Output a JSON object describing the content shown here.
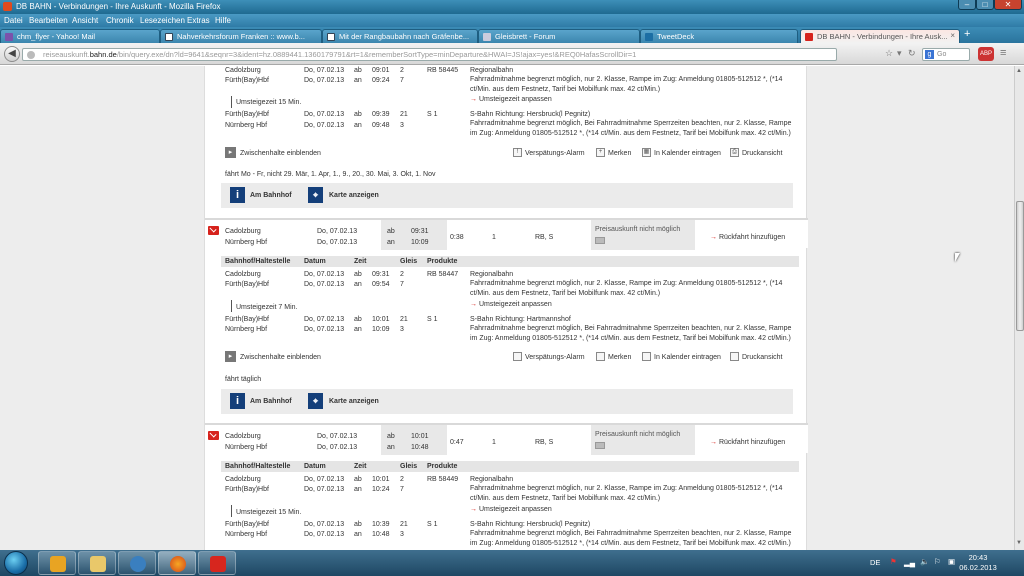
{
  "window": {
    "title": "DB BAHN - Verbindungen - Ihre Auskunft - Mozilla Firefox",
    "controls": {
      "minimize": "–",
      "maximize": "□",
      "close": "✕"
    }
  },
  "menu": [
    "Datei",
    "Bearbeiten",
    "Ansicht",
    "Chronik",
    "Lesezeichen",
    "Extras",
    "Hilfe"
  ],
  "tabs": [
    {
      "label": "chm_flyer - Yahoo! Mail",
      "icon": "mail-icon"
    },
    {
      "label": "Nahverkehrsforum Franken :: www.b...",
      "icon": "forum-icon"
    },
    {
      "label": "Mit der Rangbaubahn nach Gräfenbe...",
      "icon": "forum-icon"
    },
    {
      "label": "Gleisbrett - Forum",
      "icon": "forum-icon"
    },
    {
      "label": "TweetDeck",
      "icon": "tweetdeck-icon"
    },
    {
      "label": "DB BAHN - Verbindungen - Ihre Ausk...",
      "icon": "db-icon",
      "active": true
    }
  ],
  "newtab": "+",
  "nav": {
    "back": "◀",
    "url_domain_prefix": "reiseauskunft.",
    "url_domain": "bahn.de",
    "url_path": "/bin/query.exe/dn?ld=9641&seqnr=3&ident=hz.0889441.1360179791&rt=1&rememberSortType=minDeparture&HWAI=JS!ajax=yes!&REQ0HafasScrollDir=1",
    "search_placeholder": "Go",
    "adblock": "ABP"
  },
  "top_connection": {
    "legs": [
      {
        "from": "Cadolzburg",
        "to": "Fürth(Bay)Hbf",
        "date1": "Do, 07.02.13",
        "date2": "Do, 07.02.13",
        "ab": "ab",
        "an": "an",
        "t1": "09:01",
        "t2": "09:24",
        "g1": "2",
        "g2": "7",
        "train": "RB 58445",
        "info_title": "Regionalbahn",
        "info_text": "Fahrradmitnahme begrenzt möglich, nur 2. Klasse, Rampe im Zug: Anmeldung 01805-512512 *, (*14 ct/Min. aus dem Festnetz, Tarif bei Mobilfunk max. 42 ct/Min.)",
        "transfer_link": "Umsteigezeit anpassen"
      },
      {
        "from": "Fürth(Bay)Hbf",
        "to": "Nürnberg Hbf",
        "date1": "Do, 07.02.13",
        "date2": "Do, 07.02.13",
        "ab": "ab",
        "an": "an",
        "t1": "09:39",
        "t2": "09:48",
        "g1": "21",
        "g2": "3",
        "train": "S 1",
        "info_title": "S-Bahn Richtung: Hersbruck(l Pegnitz)",
        "info_text": "Fahrradmitnahme begrenzt möglich, Bei Fahrradmitnahme Sperrzeiten beachten, nur 2. Klasse, Rampe im Zug: Anmeldung 01805-512512 *, (*14 ct/Min. aus dem Festnetz, Tarif bei Mobilfunk max. 42 ct/Min.)"
      }
    ],
    "transfer": "Umsteigezeit 15 Min.",
    "zwischenhalte": "Zwischenhalte einblenden",
    "tools": [
      "Verspätungs-Alarm",
      "Merken",
      "In Kalender eintragen",
      "Druckansicht"
    ],
    "note": "fährt Mo - Fr, nicht 29. Mär, 1. Apr, 1., 9., 20., 30. Mai, 3. Okt, 1. Nov",
    "am_bahnhof": "Am Bahnhof",
    "karte": "Karte anzeigen"
  },
  "connections": [
    {
      "from": "Cadolzburg",
      "to": "Nürnberg Hbf",
      "date1": "Do, 07.02.13",
      "date2": "Do, 07.02.13",
      "ab": "ab",
      "an": "an",
      "dep": "09:31",
      "arr": "10:09",
      "duration": "0:38",
      "changes": "1",
      "products": "RB, S",
      "price": "Preisauskunft nicht möglich",
      "rueckfahrt": "Rückfahrt hinzufügen",
      "header": [
        "Bahnhof/Haltestelle",
        "Datum",
        "Zeit",
        "Gleis",
        "Produkte"
      ],
      "legs": [
        {
          "from": "Cadolzburg",
          "to": "Fürth(Bay)Hbf",
          "date1": "Do, 07.02.13",
          "date2": "Do, 07.02.13",
          "t1": "09:31",
          "t2": "09:54",
          "g1": "2",
          "g2": "7",
          "train": "RB 58447",
          "info_title": "Regionalbahn",
          "info_text": "Fahrradmitnahme begrenzt möglich, nur 2. Klasse, Rampe im Zug: Anmeldung 01805-512512 *, (*14 ct/Min. aus dem Festnetz, Tarif bei Mobilfunk max. 42 ct/Min.)",
          "transfer_link": "Umsteigezeit anpassen"
        },
        {
          "from": "Fürth(Bay)Hbf",
          "to": "Nürnberg Hbf",
          "date1": "Do, 07.02.13",
          "date2": "Do, 07.02.13",
          "t1": "10:01",
          "t2": "10:09",
          "g1": "21",
          "g2": "3",
          "train": "S 1",
          "info_title": "S-Bahn Richtung: Hartmannshof",
          "info_text": "Fahrradmitnahme begrenzt möglich, Bei Fahrradmitnahme Sperrzeiten beachten, nur 2. Klasse, Rampe im Zug: Anmeldung 01805-512512 *, (*14 ct/Min. aus dem Festnetz, Tarif bei Mobilfunk max. 42 ct/Min.)"
        }
      ],
      "transfer": "Umsteigezeit 7 Min.",
      "note": "fährt täglich"
    },
    {
      "from": "Cadolzburg",
      "to": "Nürnberg Hbf",
      "date1": "Do, 07.02.13",
      "date2": "Do, 07.02.13",
      "ab": "ab",
      "an": "an",
      "dep": "10:01",
      "arr": "10:48",
      "duration": "0:47",
      "changes": "1",
      "products": "RB, S",
      "price": "Preisauskunft nicht möglich",
      "rueckfahrt": "Rückfahrt hinzufügen",
      "header": [
        "Bahnhof/Haltestelle",
        "Datum",
        "Zeit",
        "Gleis",
        "Produkte"
      ],
      "legs": [
        {
          "from": "Cadolzburg",
          "to": "Fürth(Bay)Hbf",
          "date1": "Do, 07.02.13",
          "date2": "Do, 07.02.13",
          "t1": "10:01",
          "t2": "10:24",
          "g1": "2",
          "g2": "7",
          "train": "RB 58449",
          "info_title": "Regionalbahn",
          "info_text": "Fahrradmitnahme begrenzt möglich, nur 2. Klasse, Rampe im Zug: Anmeldung 01805-512512 *, (*14 ct/Min. aus dem Festnetz, Tarif bei Mobilfunk max. 42 ct/Min.)",
          "transfer_link": "Umsteigezeit anpassen"
        },
        {
          "from": "Fürth(Bay)Hbf",
          "to": "Nürnberg Hbf",
          "date1": "Do, 07.02.13",
          "date2": "Do, 07.02.13",
          "t1": "10:39",
          "t2": "10:48",
          "g1": "21",
          "g2": "3",
          "train": "S 1",
          "info_title": "S-Bahn Richtung: Hersbruck(l Pegnitz)",
          "info_text": "Fahrradmitnahme begrenzt möglich, Bei Fahrradmitnahme Sperrzeiten beachten, nur 2. Klasse, Rampe im Zug: Anmeldung 01805-512512 *, (*14 ct/Min. aus dem Festnetz, Tarif bei Mobilfunk max. 42 ct/Min.)"
        }
      ],
      "transfer": "Umsteigezeit 15 Min."
    }
  ],
  "taskbar": {
    "apps": [
      "media-player",
      "file-explorer",
      "network",
      "firefox",
      "paint"
    ],
    "lang": "DE",
    "time": "20:43",
    "date": "06.02.2013"
  },
  "colors": {
    "db_red": "#d6221c",
    "db_blue": "#143f7a",
    "titlebar": "#2f7ba6"
  }
}
